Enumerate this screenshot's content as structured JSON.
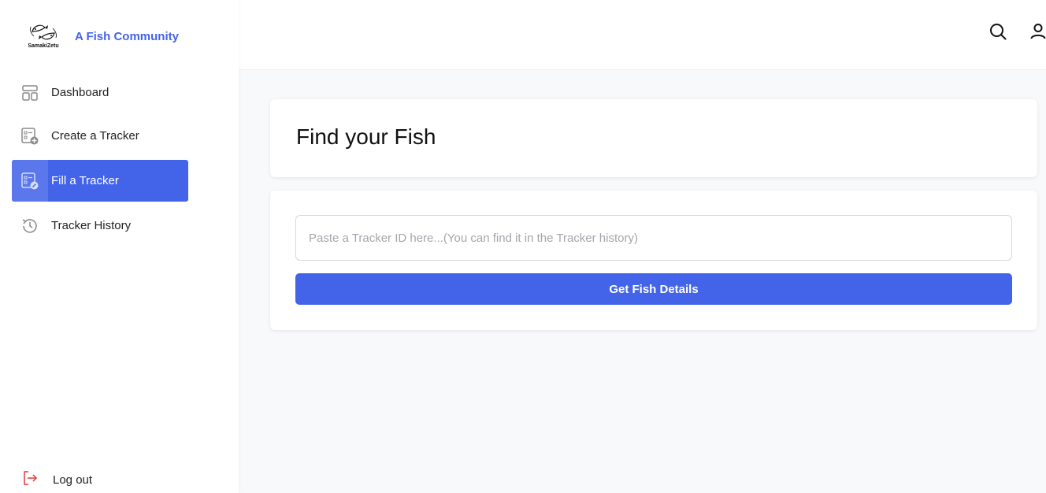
{
  "brand": {
    "logo_text": "SamakiZetu",
    "name": "A Fish Community",
    "accent_color": "#4364e8"
  },
  "sidebar": {
    "items": [
      {
        "label": "Dashboard",
        "icon": "dashboard-icon",
        "active": false
      },
      {
        "label": "Create a Tracker",
        "icon": "create-tracker-icon",
        "active": false
      },
      {
        "label": "Fill a Tracker",
        "icon": "fill-tracker-icon",
        "active": true
      },
      {
        "label": "Tracker History",
        "icon": "history-icon",
        "active": false
      }
    ],
    "logout_label": "Log out",
    "logout_icon": "logout-icon",
    "logout_color": "#e53935"
  },
  "topbar": {
    "icons": [
      "search-icon",
      "user-icon"
    ]
  },
  "main": {
    "title": "Find your Fish",
    "input_placeholder": "Paste a Tracker ID here...(You can find it in the Tracker history)",
    "input_value": "",
    "button_label": "Get Fish Details"
  }
}
